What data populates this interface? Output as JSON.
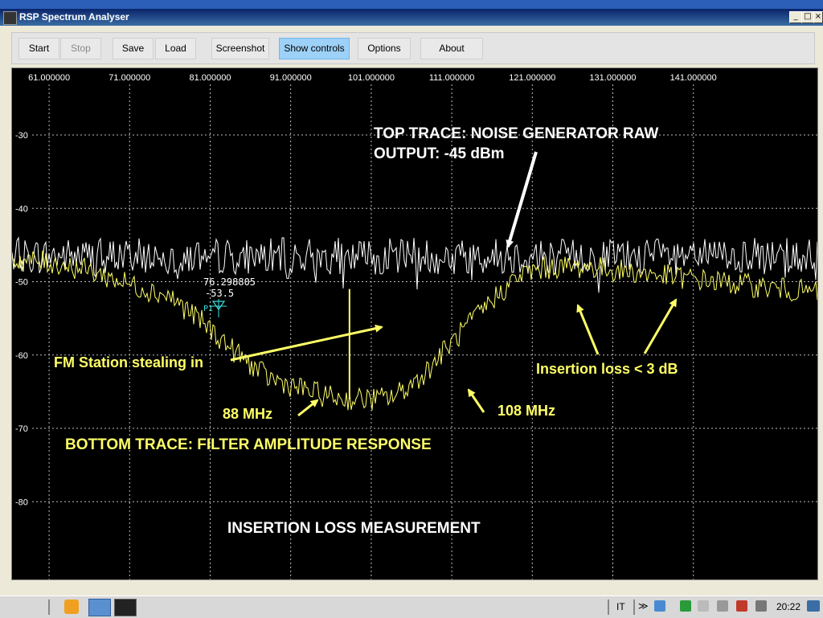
{
  "window": {
    "title": "RSP Spectrum Analyser",
    "controls": [
      "_",
      "□",
      "×"
    ]
  },
  "toolbar": {
    "start": "Start",
    "stop": "Stop",
    "save": "Save",
    "load": "Load",
    "screenshot": "Screenshot",
    "show_controls": "Show controls",
    "options": "Options",
    "about": "About"
  },
  "chart_data": {
    "type": "line",
    "x_ticks": [
      "61.000000",
      "71.000000",
      "81.000000",
      "91.000000",
      "101.000000",
      "111.000000",
      "121.000000",
      "131.000000",
      "141.000000"
    ],
    "y_ticks": [
      "-30",
      "-40",
      "-50",
      "-60",
      "-70",
      "-80"
    ],
    "xlim": [
      56.4,
      156.4
    ],
    "ylim": [
      -90.6,
      -20.9
    ],
    "grid": true,
    "series": [
      {
        "color": "#ffffff",
        "level_db": -46.5,
        "noise_db": 2.5
      },
      {
        "color": "#ffff66",
        "x": [
          56.4,
          62,
          66,
          70,
          73,
          76,
          80,
          84,
          88,
          92,
          95,
          98,
          100,
          102,
          104,
          106,
          108,
          110,
          113,
          116,
          119,
          121,
          124,
          128,
          132,
          136,
          140,
          144,
          148,
          152,
          156.4
        ],
        "y": [
          -47,
          -47.5,
          -48.5,
          -50,
          -51,
          -52,
          -55.5,
          -59.5,
          -63,
          -64.5,
          -65.5,
          -66,
          -66,
          -66,
          -65.5,
          -64,
          -62,
          -59.5,
          -56,
          -52.5,
          -49.5,
          -48.5,
          -48,
          -48,
          -48.5,
          -49,
          -49.5,
          -50,
          -50.5,
          -51,
          -51.5
        ],
        "spike": {
          "x": 98.3,
          "y": -51
        }
      }
    ],
    "marker": {
      "freq": "76.298805",
      "level": "-53.5",
      "label": "P1"
    },
    "annotations": {
      "top_trace": [
        "TOP TRACE: NOISE GENERATOR RAW",
        "OUTPUT: -45 dBm"
      ],
      "fm_station": "FM Station stealing in",
      "mhz_88": "88 MHz",
      "mhz_108": "108 MHz",
      "insertion_loss": "Insertion loss < 3 dB",
      "bottom_trace": "BOTTOM TRACE: FILTER AMPLITUDE RESPONSE",
      "measurement": "INSERTION LOSS MEASUREMENT"
    },
    "colors": {
      "annotation_yellow": "#ffff66",
      "annotation_white": "#ffffff",
      "background": "#000000"
    }
  },
  "taskbar": {
    "language": "IT",
    "clock": "20:22"
  }
}
